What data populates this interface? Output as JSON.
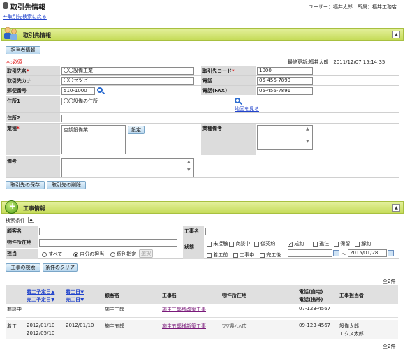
{
  "header": {
    "title": "取引先情報",
    "user": "ユーザー：福井太郎",
    "dept": "所属：福井工務店",
    "back_link": "←取引先検索に戻る"
  },
  "client_panel": {
    "title": "取引先情報",
    "collapse": "▲",
    "contact_button": "担当者情報",
    "required_note": "＊:必須",
    "last_updated": "最終更新:福井太郎　2011/12/07 15:14:35",
    "fields": {
      "name_label": "取引先名",
      "name_value": "〇〇設備工業",
      "code_label": "取引先コード",
      "code_value": "1000",
      "kana_label": "取引先カナ",
      "kana_value": "〇〇セツビ",
      "phone_label": "電話",
      "phone_value": "05-456-7890",
      "zip_label": "郵便番号",
      "zip_value": "510-1000",
      "fax_label": "電話(FAX)",
      "fax_value": "05-456-7891",
      "addr1_label": "住所1",
      "addr1_value": "〇〇設備の住所",
      "map_link": "地図を見る",
      "addr2_label": "住所2",
      "addr2_value": "",
      "industry_label": "業種",
      "industry_value": "空調設備業",
      "set_button": "設定",
      "industry_note_label": "業種備考",
      "remarks_label": "備考"
    },
    "save_button": "取引先の保存",
    "delete_button": "取引先の削除"
  },
  "work_panel": {
    "title": "工事情報",
    "collapse": "▲",
    "search_conditions": "検索条件",
    "search_toggle": "▲",
    "customer_label": "顧客名",
    "location_label": "物件所在地",
    "owner_label": "担当",
    "owner_options": [
      "すべて",
      "自分の担当",
      "個別指定"
    ],
    "owner_selected": "自分の担当",
    "select_button": "選択",
    "work_name_label": "工事名",
    "status_label": "状態",
    "status_row1": [
      {
        "label": "未接触",
        "checked": false
      },
      {
        "label": "商談中",
        "checked": false
      },
      {
        "label": "仮契約",
        "checked": false
      },
      {
        "label": "成約",
        "checked": true
      },
      {
        "label": "進注",
        "checked": false
      },
      {
        "label": "保留",
        "checked": false
      },
      {
        "label": "解約",
        "checked": false
      }
    ],
    "status_row2": [
      {
        "label": "着工前",
        "checked": false
      },
      {
        "label": "工事中",
        "checked": false
      },
      {
        "label": "完工後",
        "checked": false
      }
    ],
    "check_mark": "✓",
    "date_from": "",
    "date_sep": "～",
    "date_to": "2015/01/28",
    "search_button": "工事の検索",
    "clear_button": "条件のクリア",
    "count_top": "全2件",
    "count_bottom": "全2件",
    "columns": {
      "start_planned": "着工予定日",
      "end_planned": "完工予定日",
      "start_date": "着工日",
      "end_date": "完工日",
      "customer": "顧客名",
      "work_name": "工事名",
      "location": "物件所在地",
      "phone_home": "電話(自宅)",
      "phone_mobile": "電話(携帯)",
      "owner": "工事担当者",
      "sort_up": "▲",
      "sort_down": "▼"
    },
    "rows": [
      {
        "status": "商談中",
        "start_planned": "",
        "end_planned": "",
        "start_date": "",
        "end_date": "",
        "customer": "施主三郎",
        "work_name": "施主三郎増改築工事",
        "location": "",
        "phone": "07-123-4567",
        "owner1": "",
        "owner2": ""
      },
      {
        "status": "着工",
        "start_planned": "2012/01/10",
        "end_planned": "2012/05/10",
        "start_date": "2012/01/10",
        "end_date": "",
        "customer": "施主五郎",
        "work_name": "施主五郎様新築工事",
        "location": "▽▽県△△市",
        "phone": "09-123-4567",
        "owner1": "設備太郎",
        "owner2": "エクス太郎"
      }
    ]
  },
  "colors": {
    "panel_header": "#c6dc5a",
    "label_cell": "#dcdcdc",
    "link": "#2244cc",
    "button": "#b9d7ee",
    "required": "#dd0000"
  }
}
